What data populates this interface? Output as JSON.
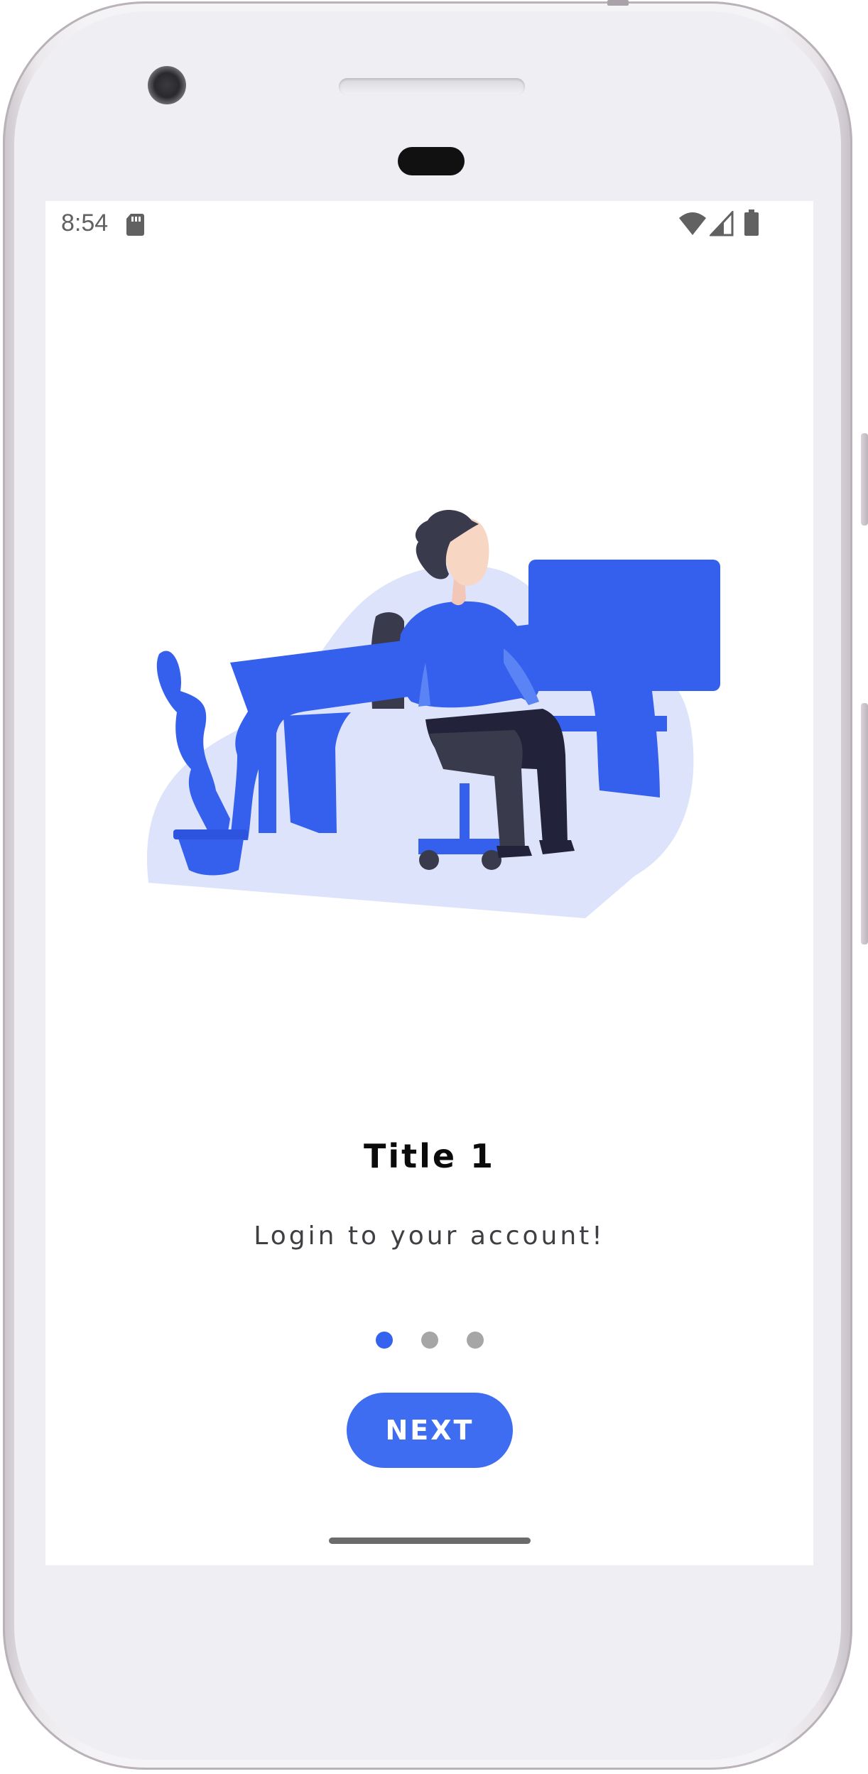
{
  "status_bar": {
    "time": "8:54",
    "icons": [
      "sd-card-icon",
      "wifi-icon",
      "cell-signal-icon",
      "battery-icon"
    ]
  },
  "onboarding": {
    "illustration": "person-at-desk-illustration",
    "title": "Title 1",
    "subtitle": "Login to your account!",
    "page_indicator": {
      "total": 3,
      "current": 1
    },
    "next_label": "NEXT"
  },
  "colors": {
    "accent": "#3563f0",
    "button": "#3e6df1",
    "blob": "#dde3fb",
    "dot_inactive": "#a6a6a6",
    "dark_figure": "#3a3a4d"
  }
}
